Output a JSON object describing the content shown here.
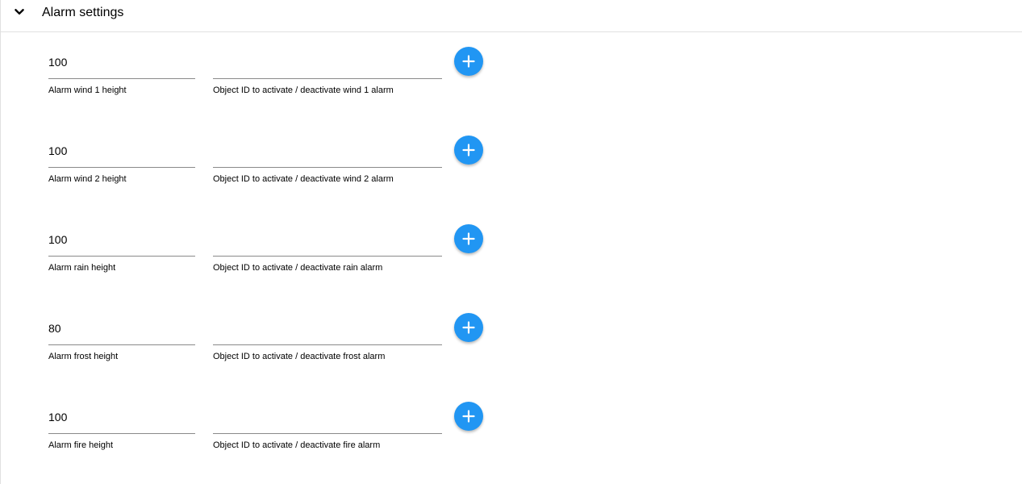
{
  "section": {
    "title": "Alarm settings"
  },
  "alarms": [
    {
      "height_value": "100",
      "height_label": "Alarm wind 1 height",
      "object_id_value": "",
      "object_id_label": "Object ID to activate / deactivate wind 1 alarm"
    },
    {
      "height_value": "100",
      "height_label": "Alarm wind 2 height",
      "object_id_value": "",
      "object_id_label": "Object ID to activate / deactivate wind 2 alarm"
    },
    {
      "height_value": "100",
      "height_label": "Alarm rain height",
      "object_id_value": "",
      "object_id_label": "Object ID to activate / deactivate rain alarm"
    },
    {
      "height_value": "80",
      "height_label": "Alarm frost height",
      "object_id_value": "",
      "object_id_label": "Object ID to activate / deactivate frost alarm"
    },
    {
      "height_value": "100",
      "height_label": "Alarm fire height",
      "object_id_value": "",
      "object_id_label": "Object ID to activate / deactivate fire alarm"
    }
  ],
  "icons": {
    "collapse": "chevron-down-icon",
    "add": "plus-icon"
  },
  "colors": {
    "accent": "#2196f3",
    "divider": "#e0e0e0",
    "underline": "#8a8a8a"
  }
}
